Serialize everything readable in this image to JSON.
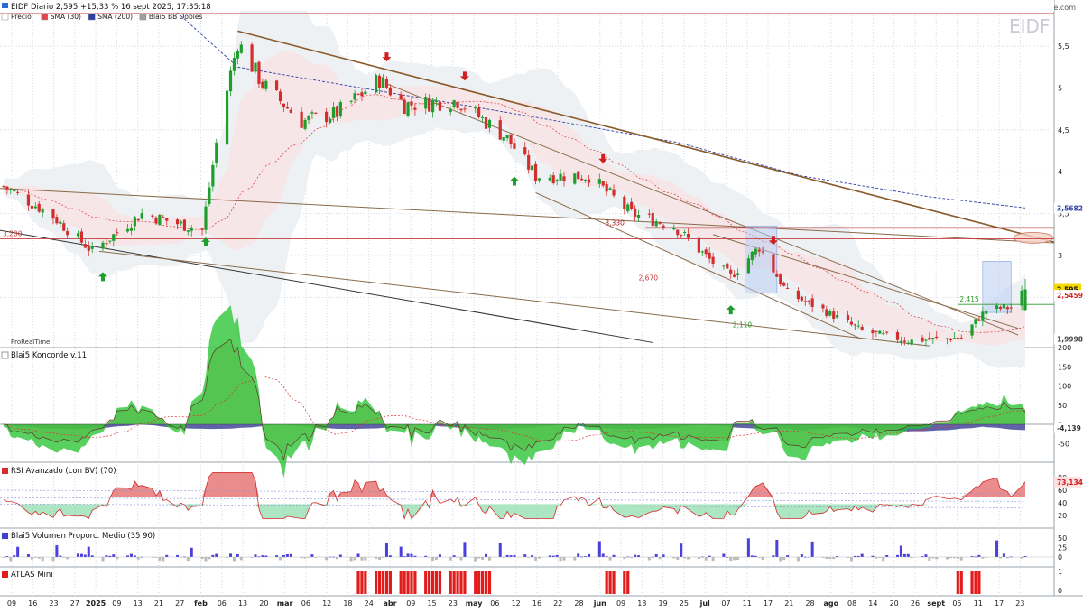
{
  "header": {
    "title": "EIDF Diario 2,595 +15,33 % 16 sept 2025, 17:35:18",
    "legend": [
      {
        "label": "Precio",
        "color": "#ffffff"
      },
      {
        "label": "SMA",
        "param": "(30)",
        "color": "#e0474c"
      },
      {
        "label": "SMA",
        "param": "(200)",
        "color": "#2d3ea3"
      },
      {
        "label": "Blai5 BB Dobles",
        "color": "#9aa0a6"
      }
    ],
    "watermark": "EIDF",
    "brand_url": "www.ProRealTime.com",
    "brand_small": "ProRealTime"
  },
  "colors": {
    "up": "#1f9e2e",
    "down": "#d32d2d",
    "grid": "#d7dbe0",
    "accent": "#f5d800"
  },
  "panes": {
    "price": {
      "yticks": [
        "5,5",
        "5",
        "4,5",
        "4",
        "3,5",
        "3",
        "2,5",
        "2"
      ],
      "ymin": 1.9,
      "ymax": 5.9,
      "last_label": "2,595",
      "sma30_label": "2,5459",
      "sma200_label": "3,5682",
      "low_label": "1,9998",
      "levels": [
        {
          "text": "3,200",
          "value": 3.2
        },
        {
          "text": "3,330",
          "value": 3.33
        },
        {
          "text": "2,670",
          "value": 2.67
        },
        {
          "text": "2,415",
          "value": 2.415
        },
        {
          "text": "2,110",
          "value": 2.11
        }
      ]
    },
    "koncorde": {
      "title": "Blai5 Koncorde v.11",
      "yticks": [
        "200",
        "150",
        "100",
        "50",
        "0",
        "-50"
      ],
      "last_label": "-4,139"
    },
    "rsi": {
      "title": "RSI Avanzado (con BV)",
      "param": "(70)",
      "yticks": [
        "80",
        "60",
        "40",
        "20"
      ],
      "last_label": "73,134"
    },
    "volume": {
      "title": "Blai5 Volumen Proporc. Medio",
      "param": "(35 90)",
      "yticks": [
        "50",
        "25",
        "0"
      ]
    },
    "atlas": {
      "title": "ATLAS Mini",
      "yticks": [
        "1",
        "0"
      ]
    }
  },
  "xaxis": {
    "labels": [
      "09",
      "16",
      "23",
      "27",
      "2025",
      "09",
      "13",
      "21",
      "27",
      "feb",
      "06",
      "13",
      "20",
      "mar",
      "06",
      "12",
      "18",
      "24",
      "abr",
      "09",
      "15",
      "23",
      "may",
      "06",
      "12",
      "16",
      "22",
      "28",
      "jun",
      "09",
      "13",
      "19",
      "25",
      "jul",
      "07",
      "11",
      "17",
      "21",
      "28",
      "ago",
      "08",
      "14",
      "20",
      "26",
      "sept",
      "05",
      "11",
      "17",
      "23"
    ]
  },
  "chart_data": {
    "type": "candlestick",
    "title": "EIDF Diario",
    "last": 2.595,
    "change_pct": 15.33,
    "date": "16 sept 2025",
    "close_path": [
      {
        "x": "2024-12-01",
        "y": 3.85
      },
      {
        "x": "2024-12-15",
        "y": 3.5
      },
      {
        "x": "2024-12-27",
        "y": 3.05
      },
      {
        "x": "2025-01-10",
        "y": 3.5
      },
      {
        "x": "2025-01-27",
        "y": 3.3
      },
      {
        "x": "2025-02-01",
        "y": 4.6
      },
      {
        "x": "2025-02-06",
        "y": 5.55
      },
      {
        "x": "2025-02-13",
        "y": 5.05
      },
      {
        "x": "2025-02-24",
        "y": 4.6
      },
      {
        "x": "2025-03-06",
        "y": 4.7
      },
      {
        "x": "2025-03-18",
        "y": 5.1
      },
      {
        "x": "2025-03-25",
        "y": 4.8
      },
      {
        "x": "2025-04-09",
        "y": 4.85
      },
      {
        "x": "2025-04-23",
        "y": 4.4
      },
      {
        "x": "2025-05-01",
        "y": 3.95
      },
      {
        "x": "2025-05-16",
        "y": 3.95
      },
      {
        "x": "2025-05-28",
        "y": 3.5
      },
      {
        "x": "2025-06-09",
        "y": 3.35
      },
      {
        "x": "2025-06-19",
        "y": 2.95
      },
      {
        "x": "2025-06-25",
        "y": 2.75
      },
      {
        "x": "2025-07-03",
        "y": 3.1
      },
      {
        "x": "2025-07-11",
        "y": 2.55
      },
      {
        "x": "2025-07-21",
        "y": 2.35
      },
      {
        "x": "2025-08-01",
        "y": 2.1
      },
      {
        "x": "2025-08-14",
        "y": 1.98
      },
      {
        "x": "2025-08-29",
        "y": 2.02
      },
      {
        "x": "2025-09-05",
        "y": 2.35
      },
      {
        "x": "2025-09-12",
        "y": 2.38
      },
      {
        "x": "2025-09-16",
        "y": 2.595
      }
    ],
    "horizontal_levels": [
      3.2,
      3.33,
      2.67,
      2.415,
      2.11
    ],
    "signals": [
      {
        "type": "sell",
        "x": "2025-03-20"
      },
      {
        "type": "sell",
        "x": "2025-04-11"
      },
      {
        "type": "sell",
        "x": "2025-05-20"
      },
      {
        "type": "sell",
        "x": "2025-07-07"
      },
      {
        "type": "buy",
        "x": "2024-12-30"
      },
      {
        "type": "buy",
        "x": "2025-01-28"
      },
      {
        "type": "buy",
        "x": "2025-04-25"
      },
      {
        "type": "buy",
        "x": "2025-06-25"
      }
    ],
    "atlas_active": [
      {
        "from": "2025-03-12",
        "to": "2025-04-10"
      },
      {
        "from": "2025-04-11",
        "to": "2025-04-18"
      },
      {
        "from": "2025-05-21",
        "to": "2025-05-27"
      },
      {
        "from": "2025-08-28",
        "to": "2025-09-03"
      }
    ]
  }
}
